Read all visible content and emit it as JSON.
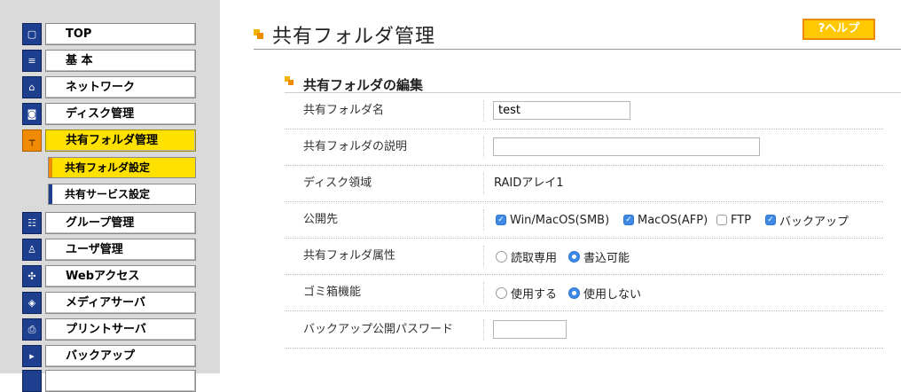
{
  "sidebar": {
    "items": [
      {
        "label": "TOP",
        "icon": "home-icon"
      },
      {
        "label": "基 本",
        "icon": "document-icon"
      },
      {
        "label": "ネットワーク",
        "icon": "network-icon"
      },
      {
        "label": "ディスク管理",
        "icon": "disk-icon"
      },
      {
        "label": "共有フォルダ管理",
        "icon": "shared-folder-icon"
      },
      {
        "label": "グループ管理",
        "icon": "group-icon"
      },
      {
        "label": "ユーザ管理",
        "icon": "user-icon"
      },
      {
        "label": "Webアクセス",
        "icon": "web-access-icon"
      },
      {
        "label": "メディアサーバ",
        "icon": "media-server-icon"
      },
      {
        "label": "プリントサーバ",
        "icon": "print-server-icon"
      },
      {
        "label": "バックアップ",
        "icon": "backup-icon"
      }
    ],
    "subitems": [
      {
        "label": "共有フォルダ設定"
      },
      {
        "label": "共有サービス設定"
      }
    ]
  },
  "header": {
    "title": "共有フォルダ管理",
    "help_label": "?ヘルプ"
  },
  "section": {
    "title": "共有フォルダの編集"
  },
  "form": {
    "name_label": "共有フォルダ名",
    "name_value": "test",
    "desc_label": "共有フォルダの説明",
    "desc_value": "",
    "area_label": "ディスク領域",
    "area_value": "RAIDアレイ1",
    "publish_label": "公開先",
    "publish_options": [
      {
        "label": "Win/MacOS(SMB)",
        "checked": true
      },
      {
        "label": "MacOS(AFP)",
        "checked": true
      },
      {
        "label": "FTP",
        "checked": false
      },
      {
        "label": "バックアップ",
        "checked": true
      }
    ],
    "attr_label": "共有フォルダ属性",
    "attr_options": [
      {
        "label": "読取専用",
        "selected": false
      },
      {
        "label": "書込可能",
        "selected": true
      }
    ],
    "trash_label": "ゴミ箱機能",
    "trash_options": [
      {
        "label": "使用する",
        "selected": false
      },
      {
        "label": "使用しない",
        "selected": true
      }
    ],
    "password_label": "バックアップ公開パスワード",
    "password_value": ""
  },
  "colors": {
    "accent_orange": "#f08a00",
    "active_yellow": "#ffe100",
    "nav_blue": "#1e3f8f",
    "checkbox_blue": "#3d8ae6"
  }
}
